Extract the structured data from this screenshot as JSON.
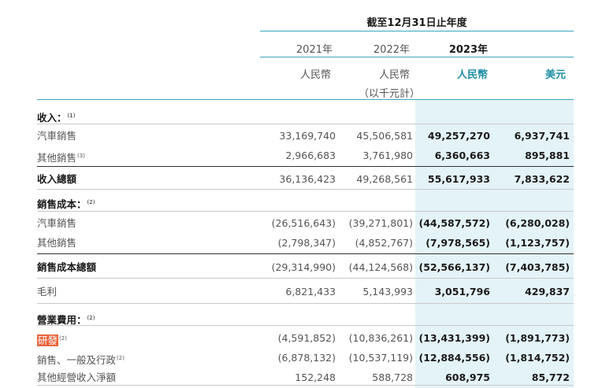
{
  "header": {
    "period_label": "截至12月31日止年度",
    "years": [
      "2021年",
      "2022年",
      "2023年"
    ],
    "currencies": [
      "人民幣",
      "人民幣",
      "人民幣",
      "美元"
    ],
    "unit_note": "（以千元計）"
  },
  "rows": [
    {
      "label": "收入：",
      "note": "(1)",
      "type": "section",
      "values": [
        "",
        "",
        "",
        ""
      ]
    },
    {
      "label": "汽車銷售",
      "note": "",
      "type": "item",
      "values": [
        "33,169,740",
        "45,506,581",
        "49,257,270",
        "6,937,741"
      ]
    },
    {
      "label": "其他銷售",
      "note": "(3)",
      "type": "item",
      "values": [
        "2,966,683",
        "3,761,980",
        "6,360,663",
        "895,881"
      ]
    },
    {
      "label": "收入總額",
      "note": "",
      "type": "total",
      "values": [
        "36,136,423",
        "49,268,561",
        "55,617,933",
        "7,833,622"
      ]
    },
    {
      "label": "銷售成本：",
      "note": "(2)",
      "type": "section",
      "values": [
        "",
        "",
        "",
        ""
      ]
    },
    {
      "label": "汽車銷售",
      "note": "",
      "type": "item",
      "values": [
        "(26,516,643)",
        "(39,271,801)",
        "(44,587,572)",
        "(6,280,028)"
      ]
    },
    {
      "label": "其他銷售",
      "note": "",
      "type": "item",
      "values": [
        "(2,798,347)",
        "(4,852,767)",
        "(7,978,565)",
        "(1,123,757)"
      ]
    },
    {
      "label": "銷售成本總額",
      "note": "",
      "type": "total",
      "values": [
        "(29,314,990)",
        "(44,124,568)",
        "(52,566,137)",
        "(7,403,785)"
      ]
    },
    {
      "label": "毛利",
      "note": "",
      "type": "item",
      "values": [
        "6,821,433",
        "5,143,993",
        "3,051,796",
        "429,837"
      ]
    },
    {
      "label": "營業費用：",
      "note": "(2)",
      "type": "section",
      "values": [
        "",
        "",
        "",
        ""
      ]
    },
    {
      "label": "研發",
      "note": "(2)",
      "type": "highlight",
      "values": [
        "(4,591,852)",
        "(10,836,261)",
        "(13,431,399)",
        "(1,891,773)"
      ]
    },
    {
      "label": "銷售、一般及行政",
      "note": "(2)",
      "type": "item",
      "values": [
        "(6,878,132)",
        "(10,537,119)",
        "(12,884,556)",
        "(1,814,752)"
      ]
    },
    {
      "label": "其他經營收入淨額",
      "note": "",
      "type": "item",
      "values": [
        "152,248",
        "588,728",
        "608,975",
        "85,772"
      ]
    }
  ]
}
